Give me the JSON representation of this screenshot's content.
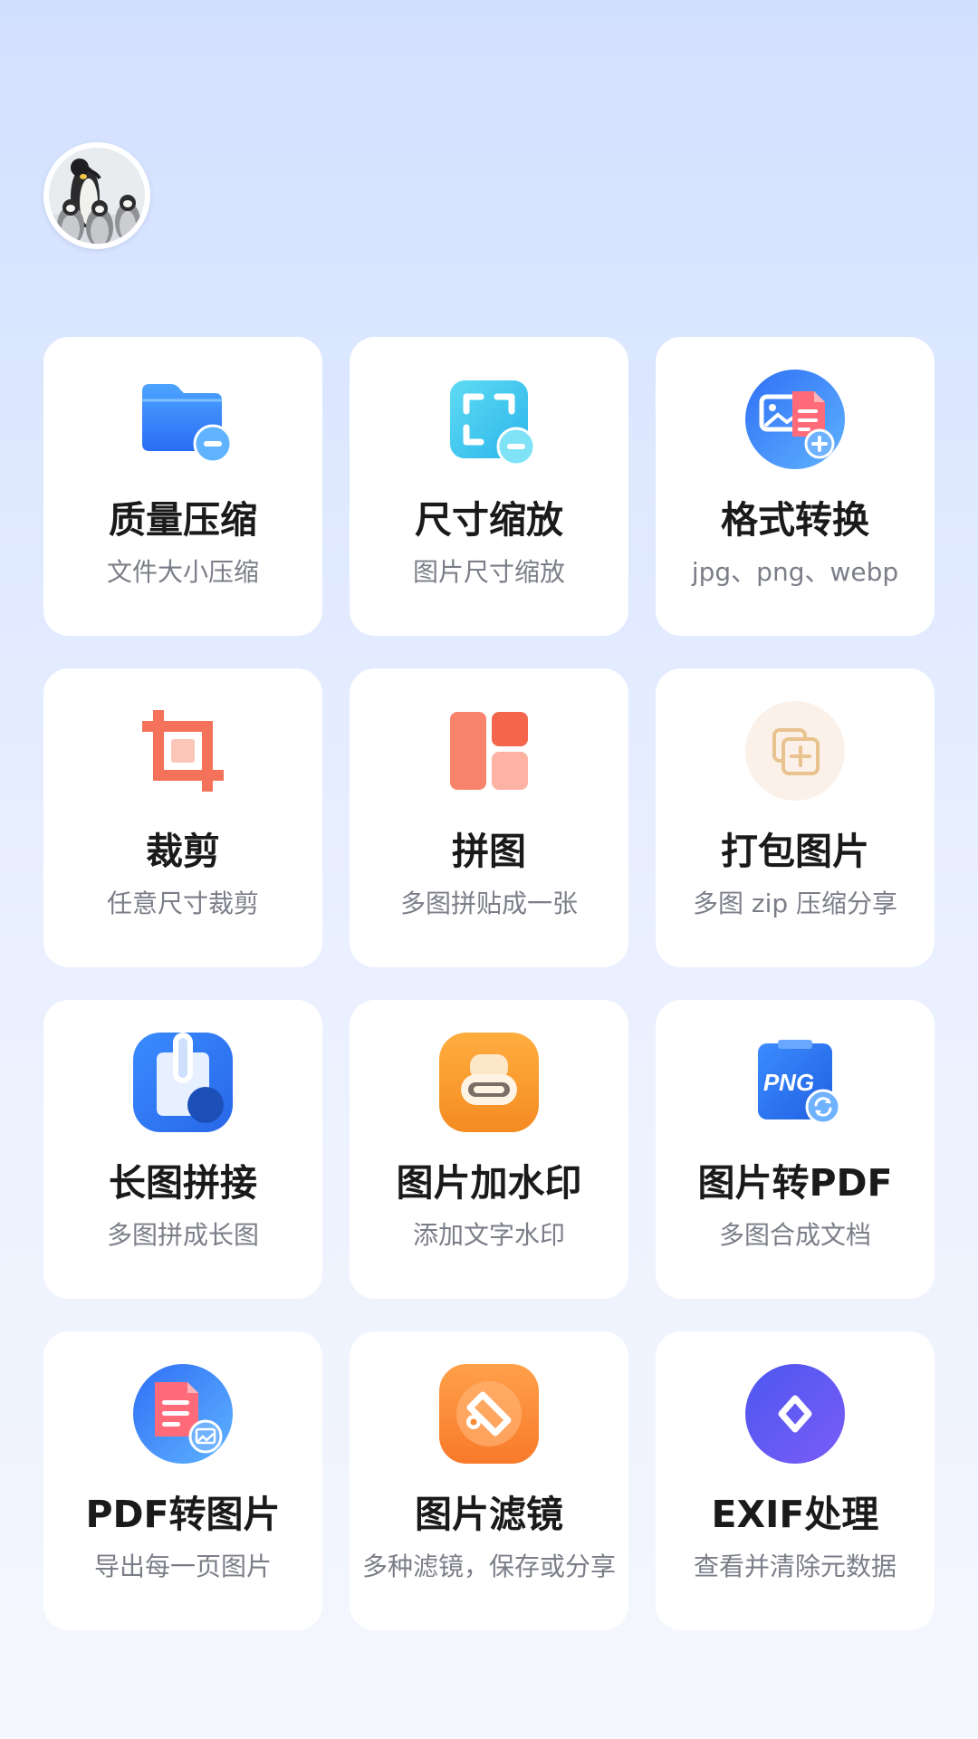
{
  "avatar": {
    "icon": "penguin-avatar"
  },
  "tools": [
    {
      "id": "quality-compress",
      "title": "质量压缩",
      "subtitle": "文件大小压缩",
      "icon": "folder-minus-icon"
    },
    {
      "id": "size-scale",
      "title": "尺寸缩放",
      "subtitle": "图片尺寸缩放",
      "icon": "resize-frame-icon"
    },
    {
      "id": "format-convert",
      "title": "格式转换",
      "subtitle": "jpg、png、webp",
      "icon": "format-convert-icon"
    },
    {
      "id": "crop",
      "title": "裁剪",
      "subtitle": "任意尺寸裁剪",
      "icon": "crop-icon"
    },
    {
      "id": "collage",
      "title": "拼图",
      "subtitle": "多图拼贴成一张",
      "icon": "collage-icon"
    },
    {
      "id": "pack-images",
      "title": "打包图片",
      "subtitle": "多图 zip 压缩分享",
      "icon": "pack-zip-icon"
    },
    {
      "id": "long-stitch",
      "title": "长图拼接",
      "subtitle": "多图拼成长图",
      "icon": "long-stitch-icon"
    },
    {
      "id": "watermark",
      "title": "图片加水印",
      "subtitle": "添加文字水印",
      "icon": "watermark-stamp-icon"
    },
    {
      "id": "image-to-pdf",
      "title": "图片转PDF",
      "subtitle": "多图合成文档",
      "icon": "png-convert-icon"
    },
    {
      "id": "pdf-to-image",
      "title": "PDF转图片",
      "subtitle": "导出每一页图片",
      "icon": "pdf-to-image-icon"
    },
    {
      "id": "filter",
      "title": "图片滤镜",
      "subtitle": "多种滤镜，保存或分享",
      "icon": "filter-icon"
    },
    {
      "id": "exif",
      "title": "EXIF处理",
      "subtitle": "查看并清除元数据",
      "icon": "exif-diamond-icon"
    }
  ]
}
